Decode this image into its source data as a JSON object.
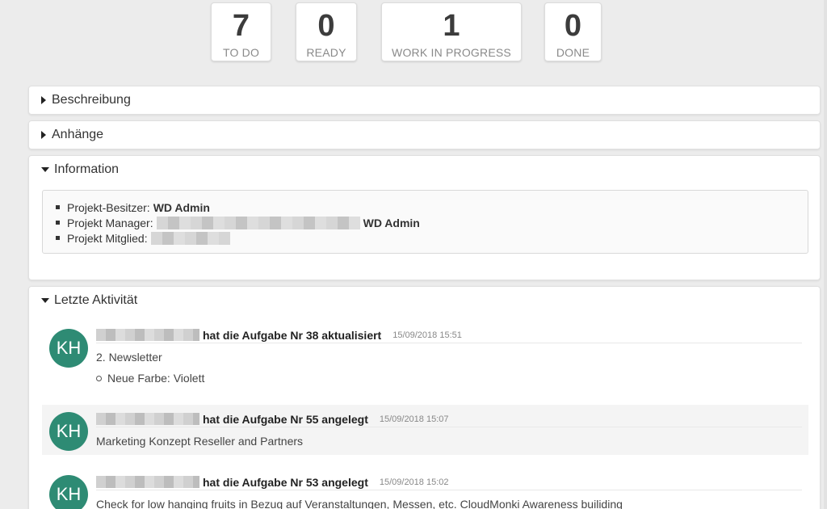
{
  "stats": [
    {
      "count": "7",
      "label": "TO DO"
    },
    {
      "count": "0",
      "label": "READY"
    },
    {
      "count": "1",
      "label": "WORK IN PROGRESS"
    },
    {
      "count": "0",
      "label": "DONE"
    }
  ],
  "panels": {
    "beschreibung": {
      "title": "Beschreibung"
    },
    "anhaenge": {
      "title": "Anhänge"
    },
    "information": {
      "title": "Information",
      "owner_label": "Projekt-Besitzer:",
      "owner_value": "WD Admin",
      "manager_label": "Projekt Manager:",
      "manager_value": "WD Admin",
      "member_label": "Projekt Mitglied:"
    },
    "activity": {
      "title": "Letzte Aktivität"
    }
  },
  "activities": [
    {
      "avatar": "KH",
      "action": "hat die Aufgabe Nr 38 aktualisiert",
      "time": "15/09/2018 15:51",
      "line1": "2. Newsletter",
      "line2": "Neue Farbe: Violett"
    },
    {
      "avatar": "KH",
      "action": "hat die Aufgabe Nr 55 angelegt",
      "time": "15/09/2018 15:07",
      "line1": "Marketing Konzept Reseller and Partners"
    },
    {
      "avatar": "KH",
      "action": "hat die Aufgabe Nr 53 angelegt",
      "time": "15/09/2018 15:02",
      "line1": "Check for low hanging fruits in Bezug auf Veranstaltungen, Messen, etc. CloudMonki Awareness builiding"
    }
  ],
  "colors": {
    "avatar": "#2e8b74",
    "background": "#ececec"
  }
}
